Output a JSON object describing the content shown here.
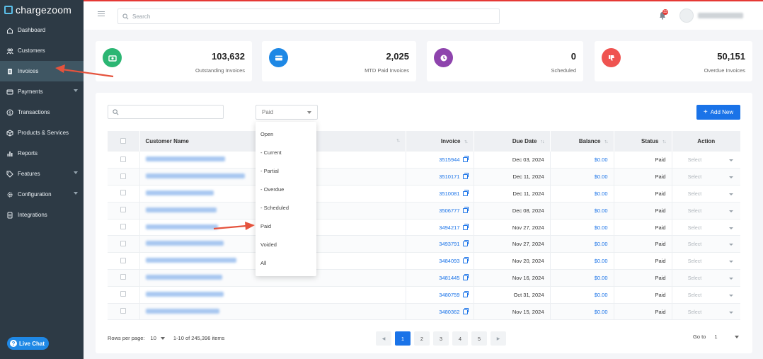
{
  "app": {
    "name": "chargezoom"
  },
  "sidebar": {
    "items": [
      {
        "label": "Dashboard",
        "icon": "home-icon",
        "active": false,
        "has_children": false
      },
      {
        "label": "Customers",
        "icon": "users-icon",
        "active": false,
        "has_children": false
      },
      {
        "label": "Invoices",
        "icon": "invoice-icon",
        "active": true,
        "has_children": false
      },
      {
        "label": "Payments",
        "icon": "card-icon",
        "active": false,
        "has_children": true
      },
      {
        "label": "Transactions",
        "icon": "dollar-icon",
        "active": false,
        "has_children": false
      },
      {
        "label": "Products & Services",
        "icon": "box-icon",
        "active": false,
        "has_children": false
      },
      {
        "label": "Reports",
        "icon": "chart-icon",
        "active": false,
        "has_children": false
      },
      {
        "label": "Features",
        "icon": "tag-icon",
        "active": false,
        "has_children": true
      },
      {
        "label": "Configuration",
        "icon": "gear-icon",
        "active": false,
        "has_children": true
      },
      {
        "label": "Integrations",
        "icon": "plug-icon",
        "active": false,
        "has_children": false
      }
    ],
    "live_chat": "Live Chat"
  },
  "topbar": {
    "search_placeholder": "Search",
    "notification_count": "33"
  },
  "stats": [
    {
      "value": "103,632",
      "label": "Outstanding Invoices",
      "color": "#2bb673",
      "icon": "cash-icon"
    },
    {
      "value": "2,025",
      "label": "MTD Paid Invoices",
      "color": "#1e88e5",
      "icon": "card-icon"
    },
    {
      "value": "0",
      "label": "Scheduled",
      "color": "#8e44ad",
      "icon": "clock-icon"
    },
    {
      "value": "50,151",
      "label": "Overdue Invoices",
      "color": "#ef5350",
      "icon": "thumbs-down-icon"
    }
  ],
  "filters": {
    "status_selected": "Paid",
    "add_new": "Add New"
  },
  "status_options": [
    "Open",
    "- Current",
    "- Partial",
    "- Overdue",
    "- Scheduled",
    "Paid",
    "Voided",
    "All"
  ],
  "table": {
    "headers": {
      "customer": "Customer Name",
      "invoice": "Invoice",
      "due_date": "Due Date",
      "balance": "Balance",
      "status": "Status",
      "action": "Action"
    },
    "action_placeholder": "Select",
    "rows": [
      {
        "invoice": "3515944",
        "due": "Dec 03, 2024",
        "balance": "$0.00",
        "status": "Paid"
      },
      {
        "invoice": "3510171",
        "due": "Dec 11, 2024",
        "balance": "$0.00",
        "status": "Paid"
      },
      {
        "invoice": "3510081",
        "due": "Dec 11, 2024",
        "balance": "$0.00",
        "status": "Paid"
      },
      {
        "invoice": "3506777",
        "due": "Dec 08, 2024",
        "balance": "$0.00",
        "status": "Paid"
      },
      {
        "invoice": "3494217",
        "due": "Nov 27, 2024",
        "balance": "$0.00",
        "status": "Paid"
      },
      {
        "invoice": "3493791",
        "due": "Nov 27, 2024",
        "balance": "$0.00",
        "status": "Paid"
      },
      {
        "invoice": "3484093",
        "due": "Nov 20, 2024",
        "balance": "$0.00",
        "status": "Paid"
      },
      {
        "invoice": "3481445",
        "due": "Nov 16, 2024",
        "balance": "$0.00",
        "status": "Paid"
      },
      {
        "invoice": "3480759",
        "due": "Oct 31, 2024",
        "balance": "$0.00",
        "status": "Paid"
      },
      {
        "invoice": "3480362",
        "due": "Nov 15, 2024",
        "balance": "$0.00",
        "status": "Paid"
      }
    ]
  },
  "pagination": {
    "rows_label": "Rows per page:",
    "rows_value": "10",
    "range": "1-10 of 245,396 items",
    "pages": [
      "1",
      "2",
      "3",
      "4",
      "5"
    ],
    "active_page": "1",
    "goto_label": "Go to",
    "goto_value": "1"
  }
}
